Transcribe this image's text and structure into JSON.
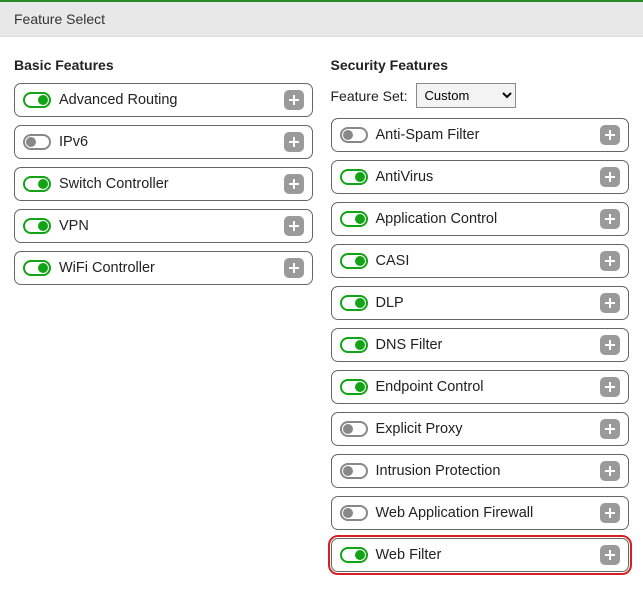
{
  "panel": {
    "title": "Feature Select"
  },
  "basic": {
    "heading": "Basic Features",
    "items": [
      {
        "label": "Advanced Routing",
        "on": true
      },
      {
        "label": "IPv6",
        "on": false
      },
      {
        "label": "Switch Controller",
        "on": true
      },
      {
        "label": "VPN",
        "on": true
      },
      {
        "label": "WiFi Controller",
        "on": true
      }
    ]
  },
  "security": {
    "heading": "Security Features",
    "featureSetLabel": "Feature Set:",
    "featureSetValue": "Custom",
    "items": [
      {
        "label": "Anti-Spam Filter",
        "on": false,
        "highlighted": false
      },
      {
        "label": "AntiVirus",
        "on": true,
        "highlighted": false
      },
      {
        "label": "Application Control",
        "on": true,
        "highlighted": false
      },
      {
        "label": "CASI",
        "on": true,
        "highlighted": false
      },
      {
        "label": "DLP",
        "on": true,
        "highlighted": false
      },
      {
        "label": "DNS Filter",
        "on": true,
        "highlighted": false
      },
      {
        "label": "Endpoint Control",
        "on": true,
        "highlighted": false
      },
      {
        "label": "Explicit Proxy",
        "on": false,
        "highlighted": false
      },
      {
        "label": "Intrusion Protection",
        "on": false,
        "highlighted": false
      },
      {
        "label": "Web Application Firewall",
        "on": false,
        "highlighted": false
      },
      {
        "label": "Web Filter",
        "on": true,
        "highlighted": true
      }
    ]
  }
}
